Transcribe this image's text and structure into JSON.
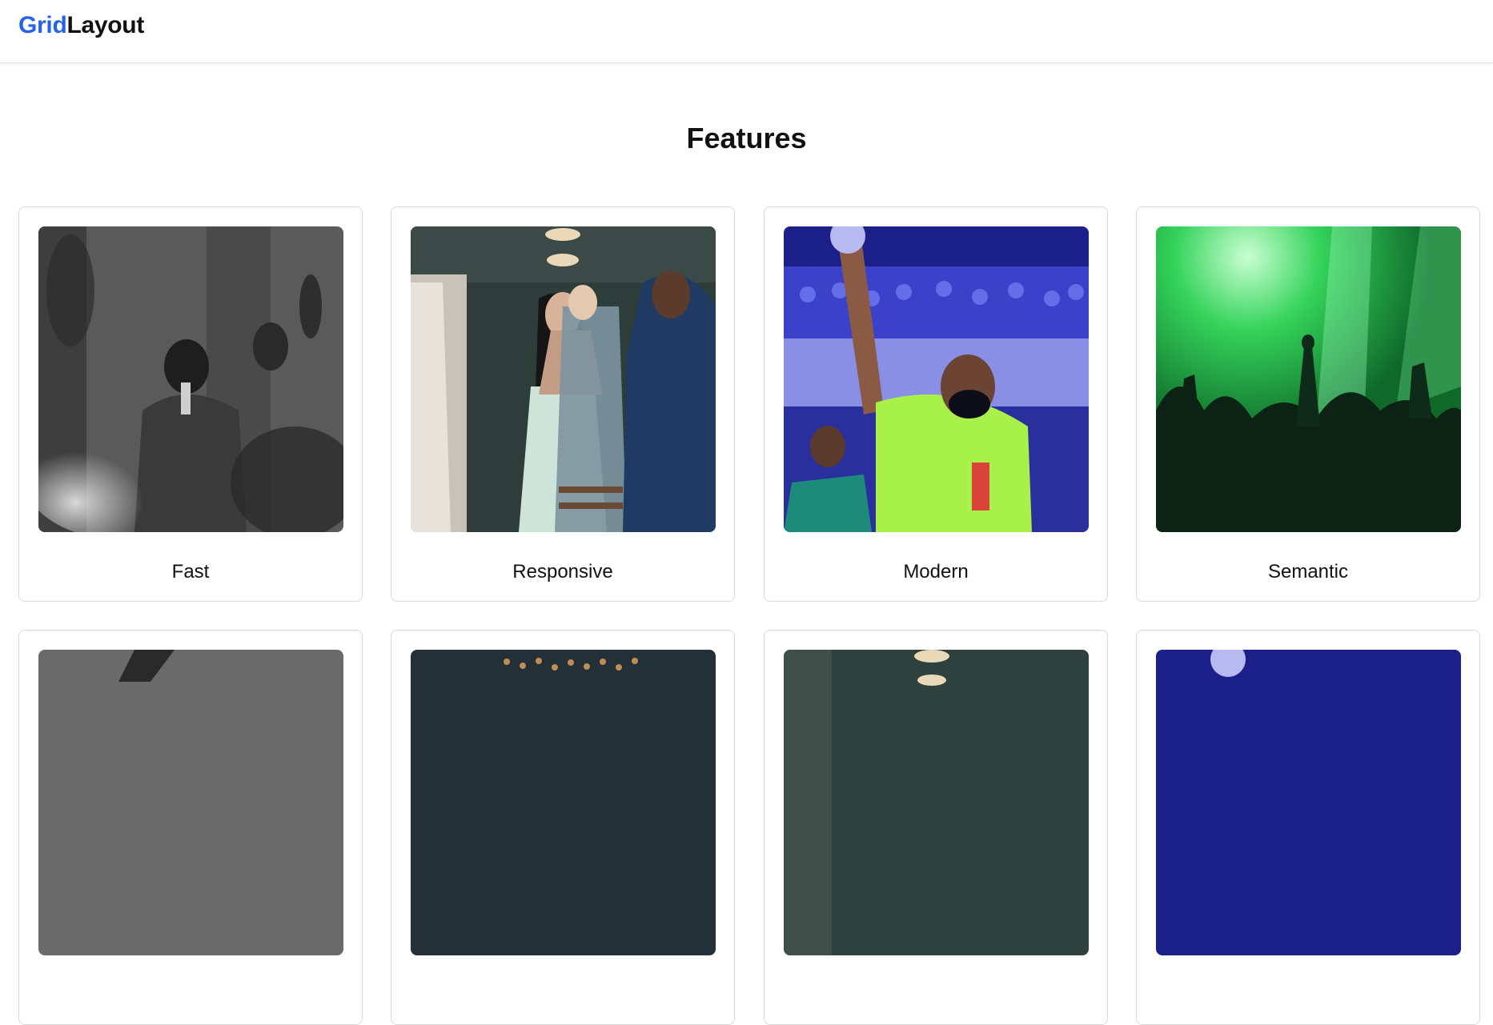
{
  "brand": {
    "part1": "Grid",
    "part2": "Layout",
    "accent_color": "#2563eb"
  },
  "section": {
    "title": "Features"
  },
  "cards": [
    {
      "label": "Fast",
      "image": "black-and-white worship singer photo"
    },
    {
      "label": "Responsive",
      "image": "women clapping in cafe photo"
    },
    {
      "label": "Modern",
      "image": "man in mask raising hand photo"
    },
    {
      "label": "Semantic",
      "image": "concert crowd in green light photo"
    },
    {
      "label": "",
      "image": "black-and-white photo (cropped)"
    },
    {
      "label": "",
      "image": "bokeh lights photo (cropped)"
    },
    {
      "label": "",
      "image": "cafe interior photo (cropped)"
    },
    {
      "label": "",
      "image": "blue stage raised hand photo (cropped)"
    }
  ]
}
